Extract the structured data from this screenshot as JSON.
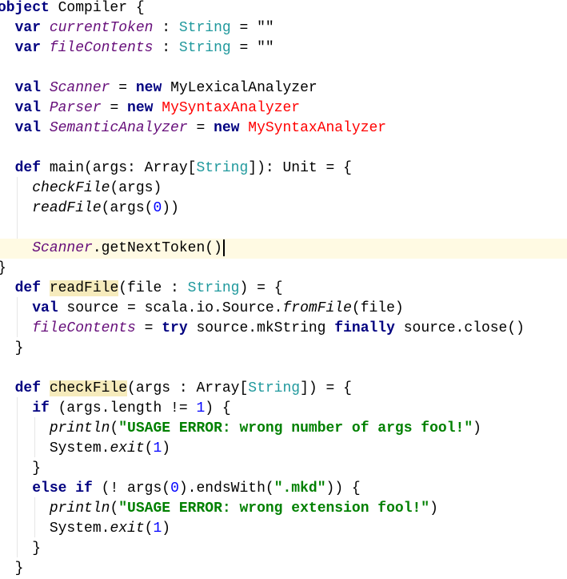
{
  "editor": {
    "language": "scala",
    "lines": [
      {
        "indent": 0,
        "tokens": [
          {
            "t": "object",
            "c": "kw"
          },
          {
            "t": " Compiler {"
          }
        ]
      },
      {
        "indent": 1,
        "tokens": [
          {
            "t": "var",
            "c": "kw"
          },
          {
            "t": " "
          },
          {
            "t": "currentToken",
            "c": "field"
          },
          {
            "t": " : "
          },
          {
            "t": "String",
            "c": "type"
          },
          {
            "t": " = "
          },
          {
            "t": "\"\"",
            "c": "str-plain"
          }
        ]
      },
      {
        "indent": 1,
        "tokens": [
          {
            "t": "var",
            "c": "kw"
          },
          {
            "t": " "
          },
          {
            "t": "fileContents",
            "c": "field"
          },
          {
            "t": " : "
          },
          {
            "t": "String",
            "c": "type"
          },
          {
            "t": " = "
          },
          {
            "t": "\"\"",
            "c": "str-plain"
          }
        ]
      },
      {
        "indent": 0,
        "tokens": []
      },
      {
        "indent": 1,
        "tokens": [
          {
            "t": "val",
            "c": "kw"
          },
          {
            "t": " "
          },
          {
            "t": "Scanner",
            "c": "field"
          },
          {
            "t": " = "
          },
          {
            "t": "new",
            "c": "kw"
          },
          {
            "t": " MyLexicalAnalyzer"
          }
        ]
      },
      {
        "indent": 1,
        "tokens": [
          {
            "t": "val",
            "c": "kw"
          },
          {
            "t": " "
          },
          {
            "t": "Parser",
            "c": "field"
          },
          {
            "t": " = "
          },
          {
            "t": "new",
            "c": "kw"
          },
          {
            "t": " "
          },
          {
            "t": "MySyntaxAnalyzer",
            "c": "cls-red"
          }
        ]
      },
      {
        "indent": 1,
        "tokens": [
          {
            "t": "val",
            "c": "kw"
          },
          {
            "t": " "
          },
          {
            "t": "SemanticAnalyzer",
            "c": "field"
          },
          {
            "t": " = "
          },
          {
            "t": "new",
            "c": "kw"
          },
          {
            "t": " "
          },
          {
            "t": "MySyntaxAnalyzer",
            "c": "cls-red"
          }
        ]
      },
      {
        "indent": 0,
        "tokens": []
      },
      {
        "indent": 1,
        "tokens": [
          {
            "t": "def",
            "c": "kw"
          },
          {
            "t": " main(args: Array["
          },
          {
            "t": "String",
            "c": "type"
          },
          {
            "t": "]): Unit = {"
          }
        ]
      },
      {
        "indent": 2,
        "tokens": [
          {
            "t": "checkFile",
            "c": "fn-italic"
          },
          {
            "t": "(args)"
          }
        ]
      },
      {
        "indent": 2,
        "tokens": [
          {
            "t": "readFile",
            "c": "fn-italic"
          },
          {
            "t": "(args("
          },
          {
            "t": "0",
            "c": "num"
          },
          {
            "t": "))"
          }
        ]
      },
      {
        "indent": 0,
        "tokens": []
      },
      {
        "indent": 2,
        "caret": true,
        "tokens": [
          {
            "t": "Scanner",
            "c": "field"
          },
          {
            "t": ".getNextToken()"
          }
        ]
      },
      {
        "indent": 0,
        "tokens": [
          {
            "t": "}"
          }
        ]
      },
      {
        "indent": 1,
        "tokens": [
          {
            "t": "def",
            "c": "kw"
          },
          {
            "t": " "
          },
          {
            "t": "readFile",
            "c": "hl-usage"
          },
          {
            "t": "(file : "
          },
          {
            "t": "String",
            "c": "type"
          },
          {
            "t": ") = {"
          }
        ]
      },
      {
        "indent": 2,
        "tokens": [
          {
            "t": "val",
            "c": "kw"
          },
          {
            "t": " source = scala.io.Source."
          },
          {
            "t": "fromFile",
            "c": "fn-italic"
          },
          {
            "t": "(file)"
          }
        ]
      },
      {
        "indent": 2,
        "tokens": [
          {
            "t": "fileContents",
            "c": "field"
          },
          {
            "t": " = "
          },
          {
            "t": "try",
            "c": "kw"
          },
          {
            "t": " source.mkString "
          },
          {
            "t": "finally",
            "c": "kw"
          },
          {
            "t": " source.close()"
          }
        ]
      },
      {
        "indent": 1,
        "tokens": [
          {
            "t": "}"
          }
        ]
      },
      {
        "indent": 0,
        "tokens": []
      },
      {
        "indent": 1,
        "tokens": [
          {
            "t": "def",
            "c": "kw"
          },
          {
            "t": " "
          },
          {
            "t": "checkFile",
            "c": "hl-usage"
          },
          {
            "t": "(args : Array["
          },
          {
            "t": "String",
            "c": "type"
          },
          {
            "t": "]) = {"
          }
        ]
      },
      {
        "indent": 2,
        "tokens": [
          {
            "t": "if",
            "c": "kw"
          },
          {
            "t": " (args.length != "
          },
          {
            "t": "1",
            "c": "num"
          },
          {
            "t": ") {"
          }
        ]
      },
      {
        "indent": 3,
        "tokens": [
          {
            "t": "println",
            "c": "fn-italic"
          },
          {
            "t": "("
          },
          {
            "t": "\"USAGE ERROR: wrong number of args fool!\"",
            "c": "str"
          },
          {
            "t": ")"
          }
        ]
      },
      {
        "indent": 3,
        "tokens": [
          {
            "t": "System."
          },
          {
            "t": "exit",
            "c": "fn-italic"
          },
          {
            "t": "("
          },
          {
            "t": "1",
            "c": "num"
          },
          {
            "t": ")"
          }
        ]
      },
      {
        "indent": 2,
        "tokens": [
          {
            "t": "}"
          }
        ]
      },
      {
        "indent": 2,
        "tokens": [
          {
            "t": "else if",
            "c": "kw"
          },
          {
            "t": " (! args("
          },
          {
            "t": "0",
            "c": "num"
          },
          {
            "t": ").endsWith("
          },
          {
            "t": "\".mkd\"",
            "c": "str"
          },
          {
            "t": ")) {"
          }
        ]
      },
      {
        "indent": 3,
        "tokens": [
          {
            "t": "println",
            "c": "fn-italic"
          },
          {
            "t": "("
          },
          {
            "t": "\"USAGE ERROR: wrong extension fool!\"",
            "c": "str"
          },
          {
            "t": ")"
          }
        ]
      },
      {
        "indent": 3,
        "tokens": [
          {
            "t": "System."
          },
          {
            "t": "exit",
            "c": "fn-italic"
          },
          {
            "t": "("
          },
          {
            "t": "1",
            "c": "num"
          },
          {
            "t": ")"
          }
        ]
      },
      {
        "indent": 2,
        "tokens": [
          {
            "t": "}"
          }
        ]
      },
      {
        "indent": 1,
        "tokens": [
          {
            "t": "}"
          }
        ]
      }
    ]
  }
}
